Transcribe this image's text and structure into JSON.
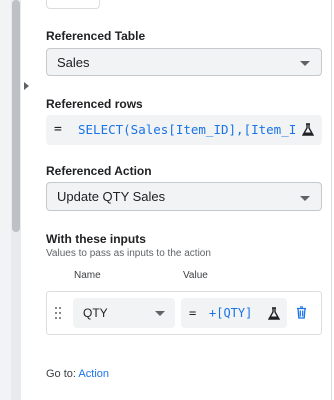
{
  "referenced_table": {
    "label": "Referenced Table",
    "value": "Sales"
  },
  "referenced_rows": {
    "label": "Referenced rows",
    "equals": "=",
    "expression": "SELECT(Sales[Item_ID],[Item_I"
  },
  "referenced_action": {
    "label": "Referenced Action",
    "value": "Update QTY Sales"
  },
  "inputs": {
    "label": "With these inputs",
    "subtitle": "Values to pass as inputs to the action",
    "col_name": "Name",
    "col_value": "Value",
    "rows": [
      {
        "name": "QTY",
        "equals": "=",
        "value": "+[QTY]"
      }
    ]
  },
  "goto": {
    "prefix": "Go to:",
    "link": "Action"
  },
  "icons": {
    "dropdown": "chevron-down-icon",
    "test": "flask-icon",
    "delete": "trash-icon",
    "drag": "drag-handle-icon"
  },
  "colors": {
    "link": "#1a73e8",
    "field_bg": "#f1f3f4",
    "delete": "#1a73e8"
  }
}
